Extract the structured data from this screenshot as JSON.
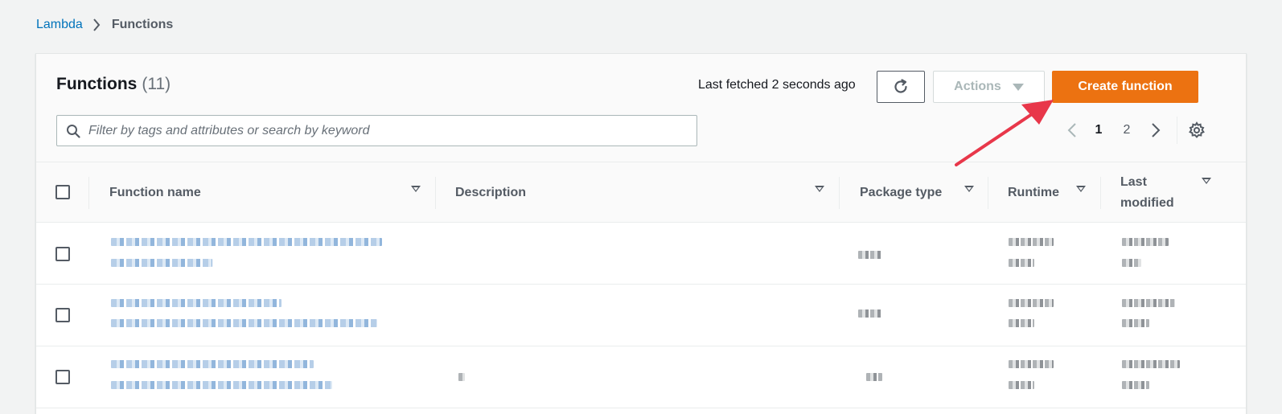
{
  "breadcrumb": {
    "root": "Lambda",
    "current": "Functions"
  },
  "panel": {
    "title": "Functions",
    "count": "(11)",
    "last_fetched": "Last fetched 2 seconds ago",
    "actions_label": "Actions",
    "create_label": "Create function",
    "search_placeholder": "Filter by tags and attributes or search by keyword"
  },
  "pagination": {
    "pages": [
      "1",
      "2"
    ],
    "current_page": "1"
  },
  "table": {
    "columns": [
      {
        "label": "Function name"
      },
      {
        "label": "Description"
      },
      {
        "label": "Package type"
      },
      {
        "label": "Runtime"
      },
      {
        "label": "Last modified"
      }
    ],
    "last_modified_line1": "Last",
    "last_modified_line2": "modified",
    "row_count_visible": 3
  },
  "icons": {
    "chevron": "chevron-right-icon",
    "refresh": "refresh-icon",
    "search": "search-icon",
    "settings": "gear-icon",
    "sort": "sort-down-icon"
  },
  "colors": {
    "primary_button": "#ec7211",
    "link": "#0073bb",
    "annotation_arrow": "#e8374a"
  }
}
